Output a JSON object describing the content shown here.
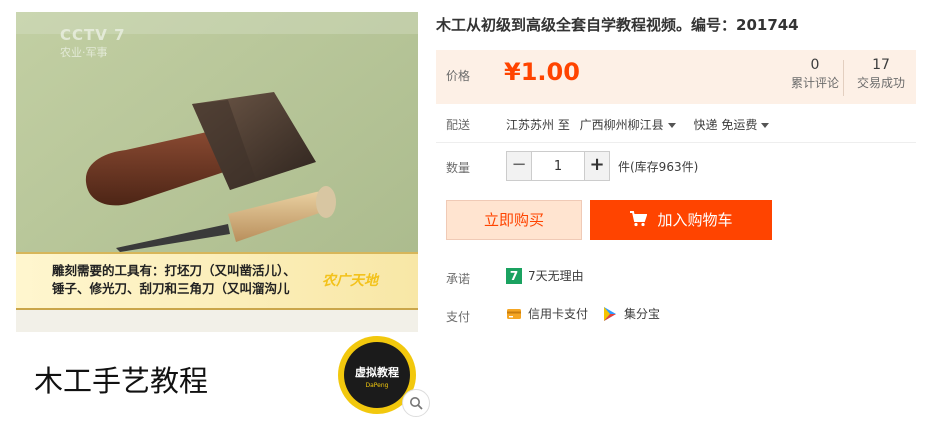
{
  "gallery": {
    "watermark_channel": "CCTV 7",
    "watermark_sub": "农业·军事",
    "caption_line1": "雕刻需要的工具有：打坯刀（又叫凿活儿）、",
    "caption_line2": "锤子、修光刀、刮刀和三角刀（又叫溜沟儿",
    "corner_logo": "农广天地",
    "course_title": "木工手艺教程",
    "badge_text": "虚拟教程",
    "badge_sub": "DaPeng",
    "zoom_icon": "magnifier-icon"
  },
  "product": {
    "title": "木工从初级到高级全套自学教程视频。编号：201744",
    "price_label": "价格",
    "price": "¥1.00",
    "reviews_count": "0",
    "reviews_label": "累计评论",
    "sales_count": "17",
    "sales_label": "交易成功",
    "ship_label": "配送",
    "ship_from": "江苏苏州 至",
    "ship_to": "广西柳州柳江县",
    "ship_method": "快递 免运费",
    "qty_label": "数量",
    "qty_value": "1",
    "qty_minus": "−",
    "qty_plus": "+",
    "stock_text": "件(库存963件)",
    "buy_now": "立即购买",
    "add_to_cart": "加入购物车",
    "promise_label": "承诺",
    "promise_text": "7天无理由",
    "promise_icon_glyph": "7",
    "pay_label": "支付",
    "pay_card": "信用卡支付",
    "pay_points": "集分宝"
  },
  "colors": {
    "accent": "#ff4400",
    "price_bg": "#fdf0e6",
    "buy_bg": "#ffe4d0",
    "promise_green": "#1aa260"
  }
}
